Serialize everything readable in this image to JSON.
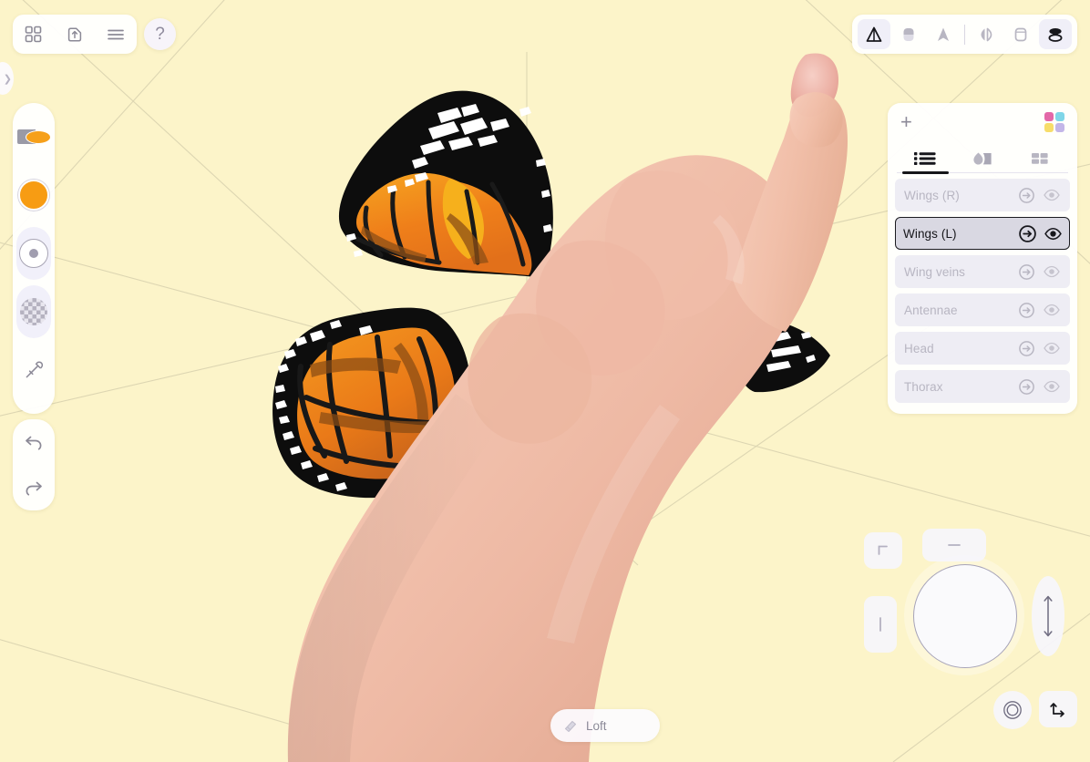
{
  "app": {
    "canvas_bg_color": "#fcf4c9",
    "grid_color": "#d9d2ae"
  },
  "top_left_toolbar": {
    "buttons": [
      {
        "name": "grid-view-icon",
        "label": "Grid view"
      },
      {
        "name": "export-icon",
        "label": "Export"
      },
      {
        "name": "menu-icon",
        "label": "Menu"
      }
    ],
    "help_label": "?"
  },
  "left_edge": {
    "expand_label": "❯"
  },
  "tool_rail": {
    "items": [
      {
        "name": "brush-preview",
        "label": "Brush preview",
        "active": false
      },
      {
        "name": "color-swatch",
        "label": "Color",
        "color": "#f79c13",
        "active": false
      },
      {
        "name": "brush-size",
        "label": "Brush size",
        "active": true
      },
      {
        "name": "opacity",
        "label": "Opacity",
        "active": true
      },
      {
        "name": "eyedropper",
        "label": "Eyedropper",
        "active": false
      }
    ]
  },
  "history": {
    "undo_label": "Undo",
    "redo_label": "Redo"
  },
  "top_right_toolbar": {
    "buttons": [
      {
        "name": "extrude-tool",
        "label": "Extrude",
        "selected": true
      },
      {
        "name": "revolve-tool",
        "label": "Revolve",
        "selected": false
      },
      {
        "name": "loft-tool",
        "label": "Loft",
        "selected": false
      },
      {
        "name": "mirror-tool",
        "label": "Mirror",
        "selected": false
      },
      {
        "name": "frame-tool",
        "label": "Frame",
        "selected": false
      },
      {
        "name": "layers-tool",
        "label": "Layers",
        "selected": true
      }
    ]
  },
  "layers_panel": {
    "add_label": "+",
    "color_wheel": {
      "name": "color-wheel-icon",
      "colors": [
        "#e368a8",
        "#7fd6e8",
        "#f7dd6a",
        "#c3b6e8"
      ]
    },
    "tabs": [
      {
        "name": "tab-layers-list",
        "label": "Layers",
        "active": true
      },
      {
        "name": "tab-materials",
        "label": "Materials",
        "active": false
      },
      {
        "name": "tab-grid",
        "label": "Grid",
        "active": false
      }
    ],
    "rows": [
      {
        "label": "Wings (R)",
        "selected": false,
        "visible": true
      },
      {
        "label": "Wings (L)",
        "selected": true,
        "visible": true
      },
      {
        "label": "Wing veins",
        "selected": false,
        "visible": true
      },
      {
        "label": "Antennae",
        "selected": false,
        "visible": true
      },
      {
        "label": "Head",
        "selected": false,
        "visible": true
      },
      {
        "label": "Thorax",
        "selected": false,
        "visible": true
      }
    ],
    "row_icons": {
      "enter": "arrow-into-circle-icon",
      "visibility": "eye-icon"
    }
  },
  "nav_widget": {
    "orbit_label": "Orbit",
    "corner_label": "Corner view",
    "dash_label": "Top view",
    "bar_label": "Side view",
    "arc_label": "Elevation",
    "target_label": "Recenter",
    "axis_label": "Axis"
  },
  "bottom_bar": {
    "loft_label": "Loft",
    "loft_icon": "loft-tool-icon"
  },
  "artwork": {
    "title": "Butterfly painting",
    "description": "Hand-painted monarch butterfly on pale yellow canvas",
    "colors": {
      "wing_orange": "#f0871e",
      "wing_amber": "#f5a623",
      "wing_dark": "#8a4f14",
      "outline_black": "#0d0d0d",
      "spot_white": "#ffffff"
    }
  }
}
